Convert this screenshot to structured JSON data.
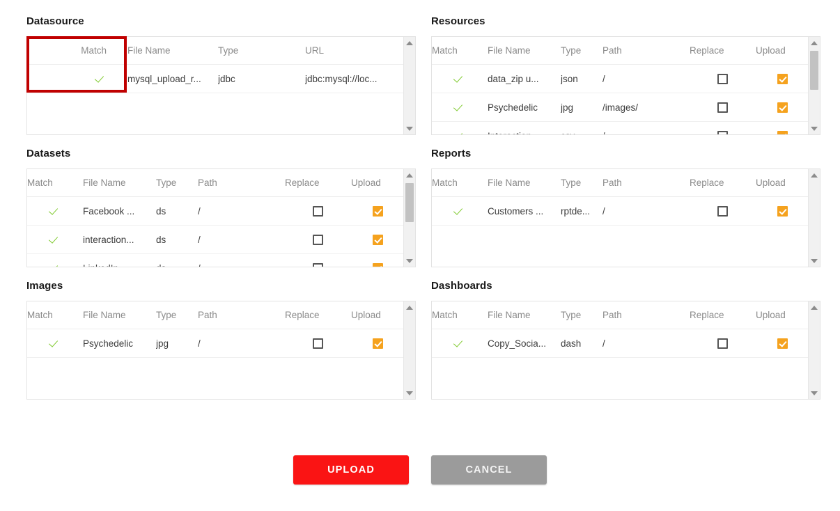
{
  "columns": {
    "match": "Match",
    "file_name": "File Name",
    "type": "Type",
    "path": "Path",
    "url": "URL",
    "replace": "Replace",
    "upload": "Upload"
  },
  "colors": {
    "highlight_box": "#C00000",
    "upload_checked": "#F5A21E",
    "match_check": "#7EC92C",
    "upload_button": "#FA1414",
    "cancel_button": "#9B9B9B",
    "header_text": "#8A8A8A"
  },
  "panels": {
    "datasource": {
      "title": "Datasource",
      "rows": [
        {
          "match": "checked",
          "file_name": "mysql_upload_r...",
          "type": "jdbc",
          "url": "jdbc:mysql://loc..."
        }
      ]
    },
    "resources": {
      "title": "Resources",
      "rows": [
        {
          "match": "checked",
          "file_name": "data_zip u...",
          "type": "json",
          "path": "/",
          "replace": false,
          "upload": true
        },
        {
          "match": "checked",
          "file_name": "Psychedelic",
          "type": "jpg",
          "path": "/images/",
          "replace": false,
          "upload": true
        },
        {
          "match": "checked",
          "file_name": "Interaction...",
          "type": "csv",
          "path": "/",
          "replace": false,
          "upload": true
        }
      ]
    },
    "datasets": {
      "title": "Datasets",
      "rows": [
        {
          "match": "checked",
          "file_name": "Facebook ...",
          "type": "ds",
          "path": "/",
          "replace": false,
          "upload": true
        },
        {
          "match": "checked",
          "file_name": "interaction...",
          "type": "ds",
          "path": "/",
          "replace": false,
          "upload": true
        },
        {
          "match": "checked",
          "file_name": "LinkedIn",
          "type": "ds",
          "path": "/",
          "replace": false,
          "upload": true
        }
      ]
    },
    "reports": {
      "title": "Reports",
      "rows": [
        {
          "match": "checked",
          "file_name": "Customers ...",
          "type": "rptde...",
          "path": "/",
          "replace": false,
          "upload": true
        }
      ]
    },
    "images": {
      "title": "Images",
      "rows": [
        {
          "match": "checked",
          "file_name": "Psychedelic",
          "type": "jpg",
          "path": "/",
          "replace": false,
          "upload": true
        }
      ]
    },
    "dashboards": {
      "title": "Dashboards",
      "rows": [
        {
          "match": "checked",
          "file_name": "Copy_Socia...",
          "type": "dash",
          "path": "/",
          "replace": false,
          "upload": true
        }
      ]
    }
  },
  "footer": {
    "upload_label": "UPLOAD",
    "cancel_label": "CANCEL"
  }
}
